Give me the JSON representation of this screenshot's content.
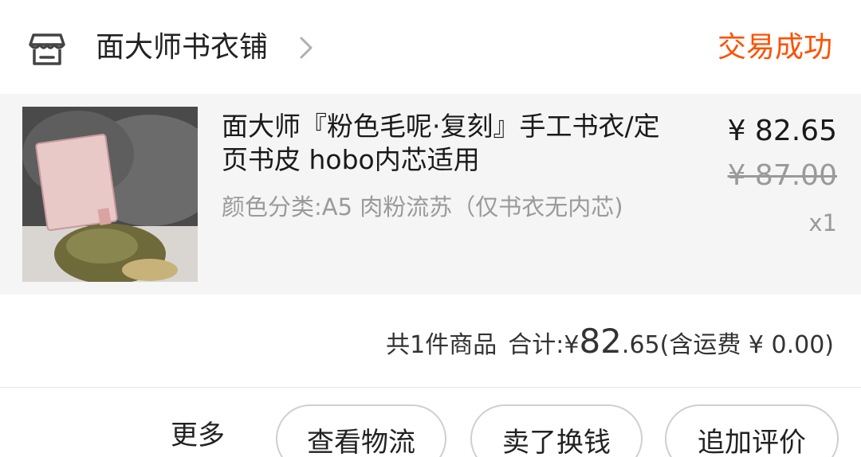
{
  "header": {
    "store_icon": "store-icon",
    "store_name": "面大师书衣铺",
    "chevron_icon": "chevron-right-icon",
    "status": "交易成功"
  },
  "item": {
    "title": "面大师『粉色毛呢·复刻』手工书衣/定页书皮  hobo内芯适用",
    "sku": "颜色分类:A5 肉粉流苏（仅书衣无内芯)",
    "price_now": "¥ 82.65",
    "price_original": "¥ 87.00",
    "quantity": "x1"
  },
  "summary": {
    "count_text": "共1件商品",
    "total_label": "合计:",
    "total_currency": "¥",
    "total_integer": "82",
    "total_decimal": ".65",
    "shipping_text": "(含运费 ¥ 0.00)"
  },
  "actions": {
    "more": "更多",
    "logistics": "查看物流",
    "resell": "卖了换钱",
    "review": "追加评价"
  },
  "colors": {
    "status": "#ff5000",
    "item_background": "#f5f5f5",
    "secondary_text": "#9a9a9a",
    "button_border": "#cfcfcf"
  }
}
